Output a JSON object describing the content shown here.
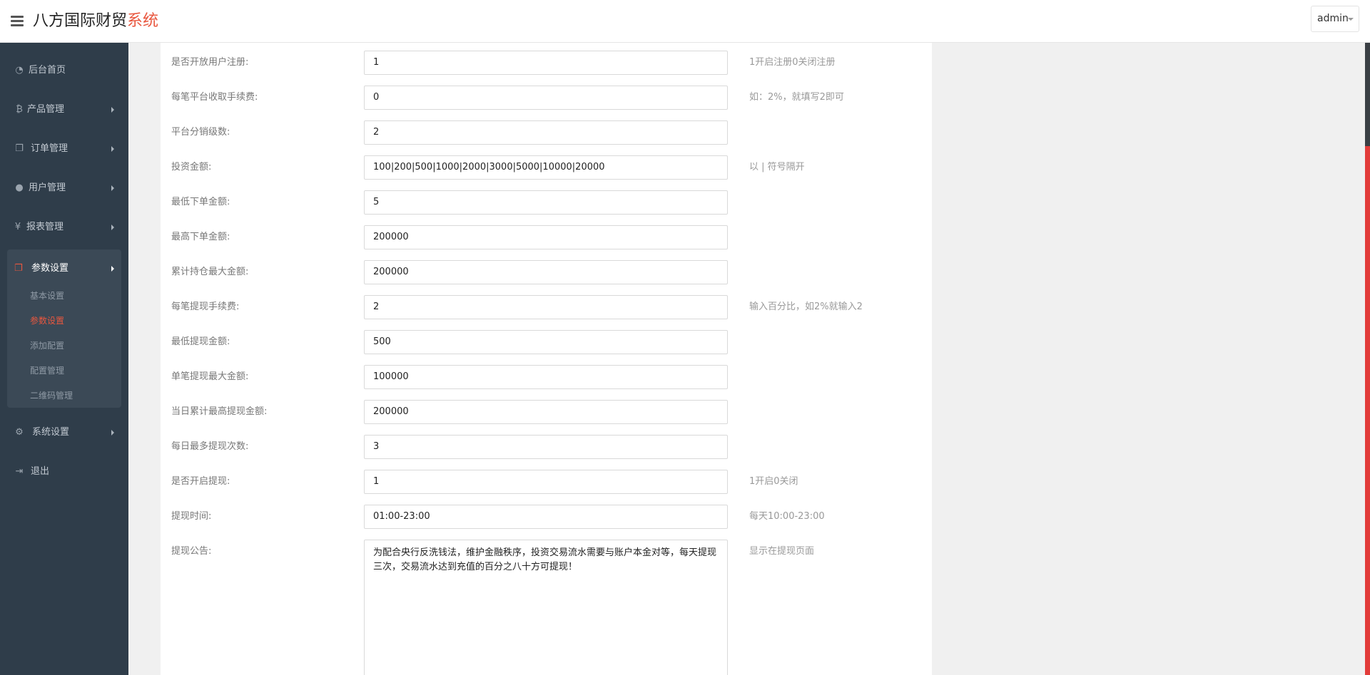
{
  "header": {
    "brand_main": "八方国际财贸",
    "brand_accent": "系统",
    "user": "admin"
  },
  "colors": {
    "accent": "#e9573f",
    "sidebar_bg": "#2f3d4a",
    "scroll_thumb": "#e23c3a"
  },
  "sidebar": {
    "items": [
      {
        "label": "后台首页",
        "icon": "dashboard-icon"
      },
      {
        "label": "产品管理",
        "icon": "bitcoin-icon"
      },
      {
        "label": "订单管理",
        "icon": "copy-icon"
      },
      {
        "label": "用户管理",
        "icon": "user-icon"
      },
      {
        "label": "报表管理",
        "icon": "yen-icon"
      },
      {
        "label": "参数设置",
        "icon": "copy-icon"
      },
      {
        "label": "系统设置",
        "icon": "gears-icon"
      },
      {
        "label": "退出",
        "icon": "sign-out-icon"
      }
    ],
    "sub_items": [
      "基本设置",
      "参数设置",
      "添加配置",
      "配置管理",
      "二维码管理"
    ]
  },
  "form": {
    "rows": [
      {
        "label": "是否开放用户注册:",
        "value": "1",
        "hint": "1开启注册0关闭注册"
      },
      {
        "label": "每笔平台收取手续费:",
        "value": "0",
        "hint": "如：2%，就填写2即可"
      },
      {
        "label": "平台分销级数:",
        "value": "2",
        "hint": ""
      },
      {
        "label": "投资金额:",
        "value": "100|200|500|1000|2000|3000|5000|10000|20000",
        "hint": "以 | 符号隔开"
      },
      {
        "label": "最低下单金额:",
        "value": "5",
        "hint": ""
      },
      {
        "label": "最高下单金额:",
        "value": "200000",
        "hint": ""
      },
      {
        "label": "累计持仓最大金额:",
        "value": "200000",
        "hint": ""
      },
      {
        "label": "每笔提现手续费:",
        "value": "2",
        "hint": "输入百分比，如2%就输入2"
      },
      {
        "label": "最低提现金额:",
        "value": "500",
        "hint": ""
      },
      {
        "label": "单笔提现最大金额:",
        "value": "100000",
        "hint": ""
      },
      {
        "label": "当日累计最高提现金额:",
        "value": "200000",
        "hint": ""
      },
      {
        "label": "每日最多提现次数:",
        "value": "3",
        "hint": ""
      },
      {
        "label": "是否开启提现:",
        "value": "1",
        "hint": "1开启0关闭"
      },
      {
        "label": "提现时间:",
        "value": "01:00-23:00",
        "hint": "每天10:00-23:00"
      }
    ],
    "notice": {
      "label": "提现公告:",
      "value": "为配合央行反洗钱法，维护金融秩序，投资交易流水需要与账户本金对等，每天提现三次，交易流水达到充值的百分之八十方可提现！",
      "hint": "显示在提现页面"
    }
  }
}
